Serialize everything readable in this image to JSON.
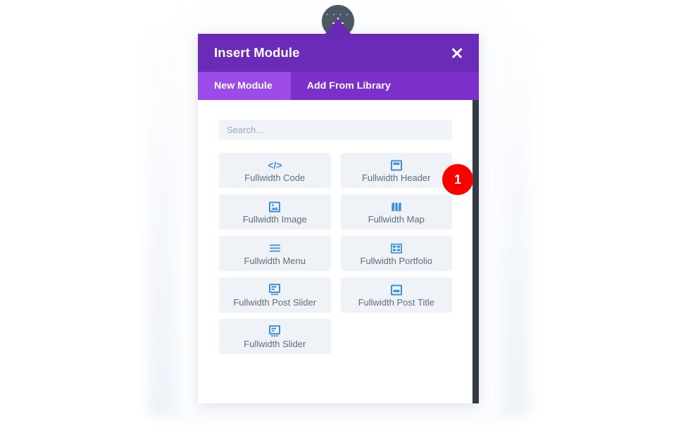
{
  "add_button": {
    "name": "add-module-button",
    "icon": "plus-icon"
  },
  "modal": {
    "title": "Insert Module",
    "close_label": "✕",
    "tabs": [
      {
        "label": "New Module",
        "active": true
      },
      {
        "label": "Add From Library",
        "active": false
      }
    ],
    "search": {
      "placeholder": "Search...",
      "value": ""
    },
    "modules": [
      {
        "label": "Fullwidth Code",
        "icon": "code-icon"
      },
      {
        "label": "Fullwidth Header",
        "icon": "header-icon"
      },
      {
        "label": "Fullwidth Image",
        "icon": "image-icon"
      },
      {
        "label": "Fullwidth Map",
        "icon": "map-icon"
      },
      {
        "label": "Fullwidth Menu",
        "icon": "menu-icon"
      },
      {
        "label": "Fullwidth Portfolio",
        "icon": "portfolio-grid-icon"
      },
      {
        "label": "Fullwidth Post Slider",
        "icon": "post-slider-icon"
      },
      {
        "label": "Fullwidth Post Title",
        "icon": "post-title-icon"
      },
      {
        "label": "Fullwidth Slider",
        "icon": "slider-icon"
      }
    ]
  },
  "annotations": [
    {
      "number": "1",
      "color": "#fc0000"
    }
  ],
  "colors": {
    "header_purple": "#6b2ab8",
    "tabbar_purple": "#7b31c9",
    "active_tab_purple": "#9b4ce8",
    "tile_bg": "#eff3f8",
    "icon_blue": "#3f8edc",
    "scrollbar_dark": "#333a44",
    "badge_red": "#fc0000"
  }
}
